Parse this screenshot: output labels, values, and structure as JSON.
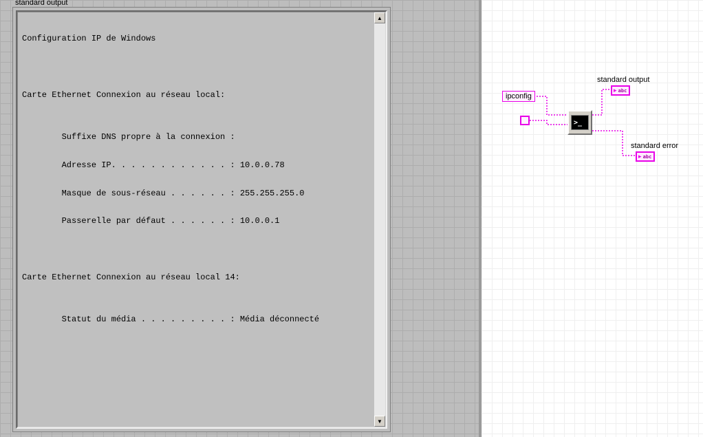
{
  "front_panel": {
    "group_label": "standard output",
    "output_text": "\nConfiguration IP de Windows\n\n\n\nCarte Ethernet Connexion au réseau local:\n\n\n        Suffixe DNS propre à la connexion :\n\n        Adresse IP. . . . . . . . . . . . : 10.0.0.78\n\n        Masque de sous-réseau . . . . . . : 255.255.255.0\n\n        Passerelle par défaut . . . . . . : 10.0.0.1\n\n\n\nCarte Ethernet Connexion au réseau local 14:\n\n\n        Statut du média . . . . . . . . . : Média déconnecté"
  },
  "block_diagram": {
    "cmd_constant": "ipconfig",
    "output_label": "standard output",
    "error_label": "standard error",
    "indicator_glyph": "abc"
  }
}
